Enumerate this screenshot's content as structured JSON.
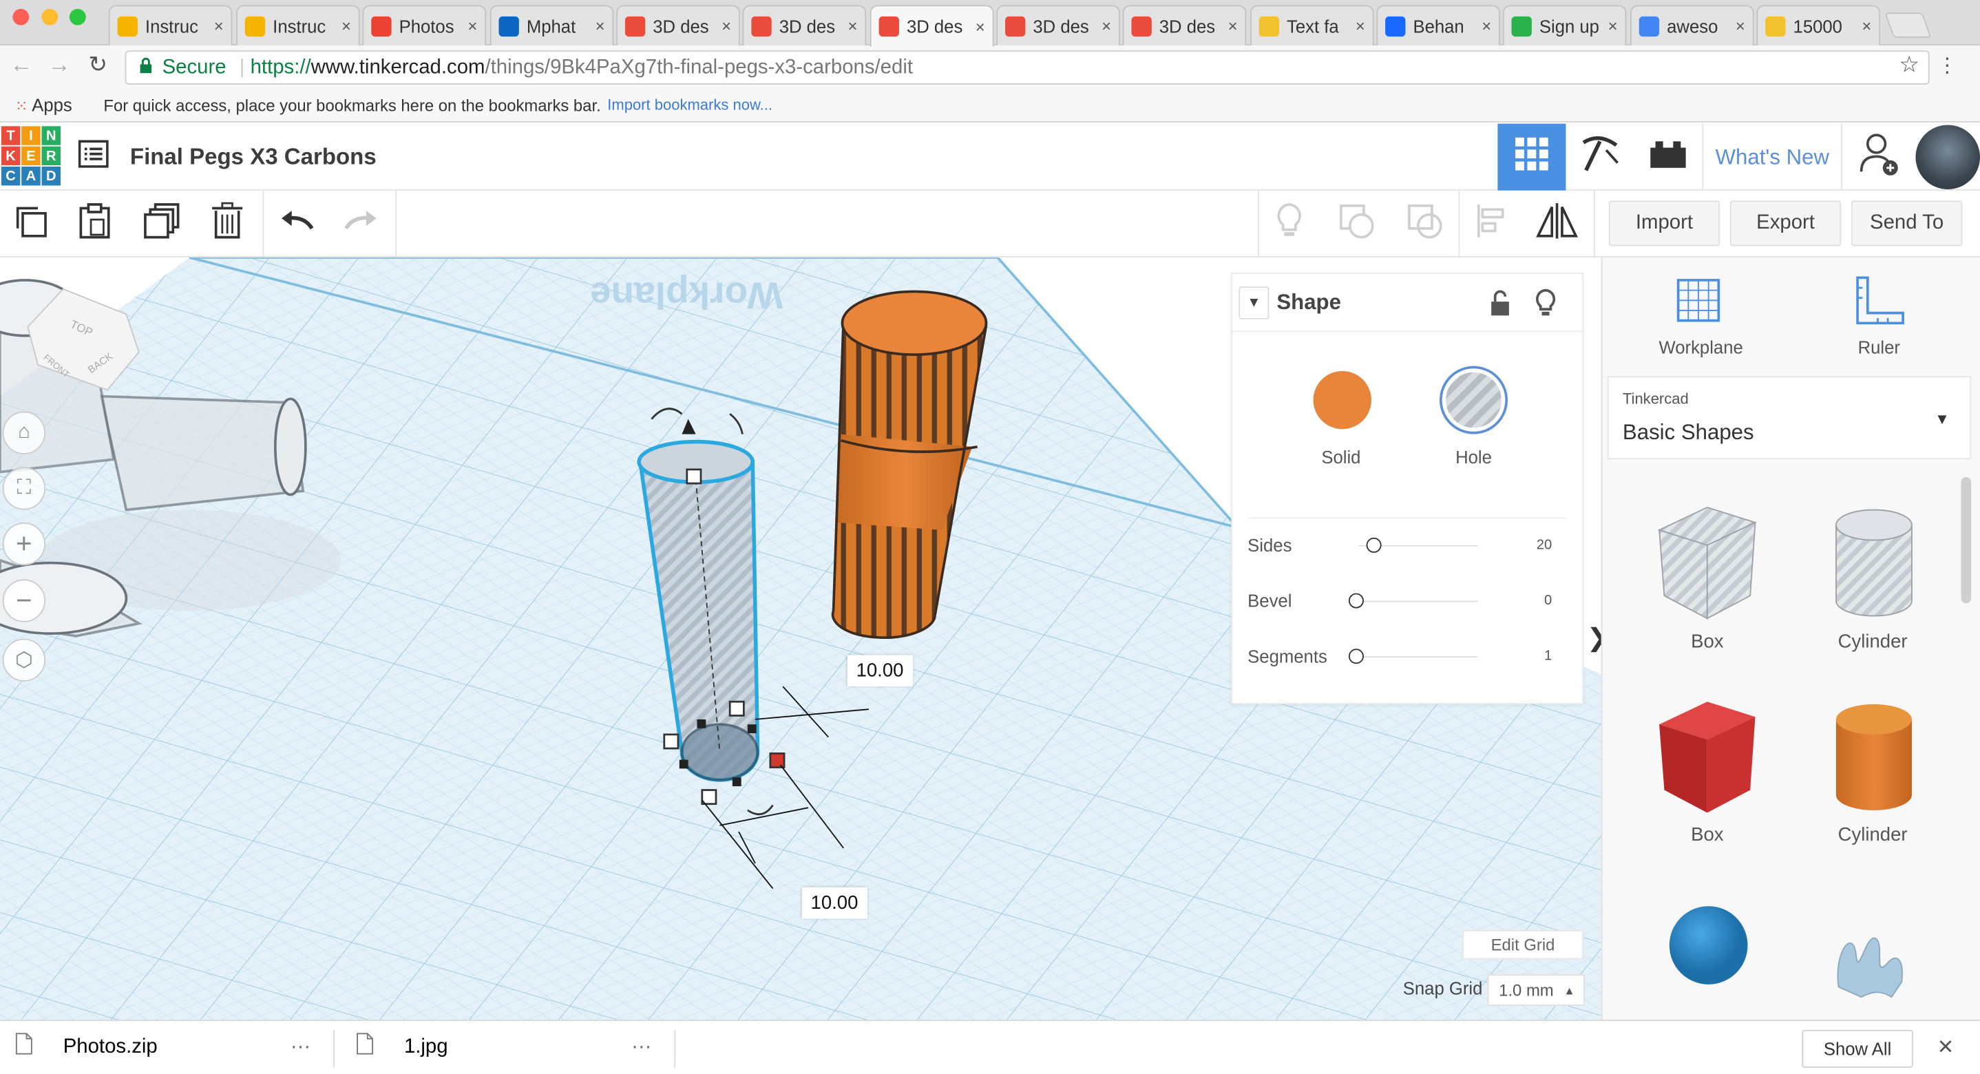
{
  "browser": {
    "tabs": [
      {
        "label": "Instruc",
        "icon": "instructables-icon",
        "color": "#f4b400"
      },
      {
        "label": "Instruc",
        "icon": "instructables-icon",
        "color": "#f4b400"
      },
      {
        "label": "Photos",
        "icon": "google-photos-icon",
        "color": "#ea4335"
      },
      {
        "label": "Mphat",
        "icon": "linkedin-icon",
        "color": "#0a66c2"
      },
      {
        "label": "3D des",
        "icon": "tinkercad-icon",
        "color": "#e94b3c"
      },
      {
        "label": "3D des",
        "icon": "tinkercad-icon",
        "color": "#e94b3c"
      },
      {
        "label": "3D des",
        "icon": "tinkercad-icon",
        "color": "#e94b3c",
        "active": true
      },
      {
        "label": "3D des",
        "icon": "tinkercad-icon",
        "color": "#e94b3c"
      },
      {
        "label": "3D des",
        "icon": "tinkercad-icon",
        "color": "#e94b3c"
      },
      {
        "label": "Text fa",
        "icon": "emoji-icon",
        "color": "#f2c12e"
      },
      {
        "label": "Behan",
        "icon": "behance-icon",
        "color": "#1769ff"
      },
      {
        "label": "Sign up",
        "icon": "lightning-icon",
        "color": "#2bb24c"
      },
      {
        "label": "aweso",
        "icon": "google-icon",
        "color": "#4285f4"
      },
      {
        "label": "15000",
        "icon": "smiley-icon",
        "color": "#f2c12e"
      }
    ],
    "close_glyph": "×",
    "secure_label": "Secure",
    "url_scheme": "https://",
    "url_host": "www.tinkercad.com",
    "url_path": "/things/9Bk4PaXg7th-final-pegs-x3-carbons/edit",
    "apps_label": "Apps",
    "bookmarks_hint": "For quick access, place your bookmarks here on the bookmarks bar.",
    "import_bookmarks": "Import bookmarks now..."
  },
  "header": {
    "logo_letters": [
      "T",
      "I",
      "N",
      "K",
      "E",
      "R",
      "C",
      "A",
      "D"
    ],
    "logo_colors": [
      "#e94b3c",
      "#f39c12",
      "#27ae60",
      "#e94b3c",
      "#f39c12",
      "#27ae60",
      "#2980b9",
      "#2980b9",
      "#2980b9"
    ],
    "title": "Final Pegs X3 Carbons",
    "whats_new": "What's New"
  },
  "toolbar": {
    "import": "Import",
    "export": "Export",
    "send_to": "Send To"
  },
  "inspector": {
    "title": "Shape",
    "solid_label": "Solid",
    "hole_label": "Hole",
    "solid_color": "#e8853a",
    "params": [
      {
        "label": "Sides",
        "value": "20",
        "level": 0.15
      },
      {
        "label": "Bevel",
        "value": "0",
        "level": 0
      },
      {
        "label": "Segments",
        "value": "1",
        "level": 0
      }
    ]
  },
  "workspace": {
    "dim_top": "10.00",
    "dim_bottom": "10.00",
    "workplane_text": "Workplane",
    "edit_grid": "Edit Grid",
    "snap_grid_label": "Snap Grid",
    "snap_grid_value": "1.0 mm",
    "viewcube_top": "TOP",
    "viewcube_front": "FRONT",
    "viewcube_back": "BACK"
  },
  "rightpanel": {
    "workplane": "Workplane",
    "ruler": "Ruler",
    "library_source": "Tinkercad",
    "library_name": "Basic Shapes",
    "shapes": [
      {
        "label": "Box"
      },
      {
        "label": "Cylinder"
      },
      {
        "label": "Box"
      },
      {
        "label": "Cylinder"
      },
      {
        "label": ""
      },
      {
        "label": ""
      }
    ]
  },
  "downloads": {
    "items": [
      {
        "name": "Photos.zip"
      },
      {
        "name": "1.jpg"
      }
    ],
    "more_glyph": "···",
    "show_all": "Show All",
    "close_glyph": "✕"
  }
}
